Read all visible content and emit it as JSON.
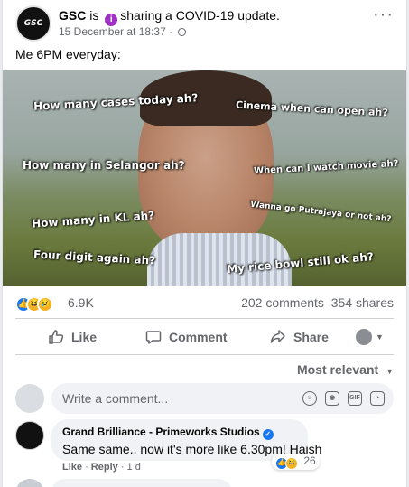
{
  "post": {
    "page_name": "GSC",
    "status_prefix": "is",
    "status_text": "sharing a COVID-19 update.",
    "timestamp": "15 December at 18:37 ·",
    "avatar_text": "GSC",
    "caption": "Me 6PM everyday:"
  },
  "meme_text": [
    "How many cases today ah?",
    "Cinema when can open ah?",
    "How many in Selangor ah?",
    "When can I watch movie ah?",
    "How many in KL ah?",
    "Wanna go Putrajaya or not ah?",
    "Four digit again ah?",
    "My rice bowl still ok ah?"
  ],
  "stats": {
    "reaction_count": "6.9K",
    "comments": "202 comments",
    "shares": "354 shares"
  },
  "actions": {
    "like": "Like",
    "comment": "Comment",
    "share": "Share"
  },
  "sort_label": "Most relevant",
  "comment_input": {
    "placeholder": "Write a comment..."
  },
  "comments": [
    {
      "author": "Grand Brilliance - Primeworks Studios",
      "text": "Same same.. now it's more like 6.30pm! Haish",
      "like_label": "Like",
      "reply_label": "Reply",
      "time": "1 d",
      "reaction_count": "26"
    }
  ],
  "colors": {
    "accent": "#1877f2",
    "info_badge": "#a033c5",
    "secondary_text": "#65676b"
  }
}
